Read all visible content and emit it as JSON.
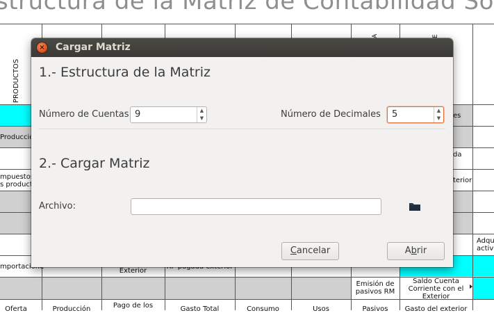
{
  "background": {
    "title": "structura de la Matriz de Contabilidad Soci",
    "header_vertical": "PRODUCTOS",
    "header_a": "A",
    "header_e": "E",
    "row_labels": [
      "Producció",
      "mpuestos\ns producto",
      "mportacione"
    ],
    "right_col_fragments": [
      "es",
      "da",
      "terior"
    ],
    "far_right_fragment": "Adqu\nactivo",
    "cell_exterior": "Exterior",
    "cell_rp_pagada": "RP pagada exterior",
    "cell_emision": "Emisión de\npasivos RM",
    "cell_saldo": "Saldo Cuenta\nCorriente con el\nExterior",
    "bottom_row": [
      "Oferta",
      "Producción",
      "Pago de los",
      "Gasto Total",
      "Consumo",
      "Usos",
      "Pasivos",
      "Gasto del exterior"
    ]
  },
  "dialog": {
    "title": "Cargar Matriz",
    "section1_title": "1.- Estructura de la Matriz",
    "num_cuentas_label": "Número de Cuentas:",
    "num_cuentas_value": "9",
    "num_decimales_label": "Número de Decimales",
    "num_decimales_value": "5",
    "section2_title": "2.- Cargar Matriz",
    "archivo_label": "Archivo:",
    "archivo_value": "",
    "cancel_first": "C",
    "cancel_rest": "ancelar",
    "open_first": "A",
    "open_mid": "b",
    "open_rest": "rir",
    "icons": {
      "close": "close-icon",
      "folder": "folder-icon",
      "spin_up": "chevron-up-icon",
      "spin_down": "chevron-down-icon"
    },
    "colors": {
      "titlebar": "#3b3a36",
      "close_button": "#e2531d",
      "focus_border": "#e0733b",
      "cell_highlight": "#00ffff"
    }
  }
}
